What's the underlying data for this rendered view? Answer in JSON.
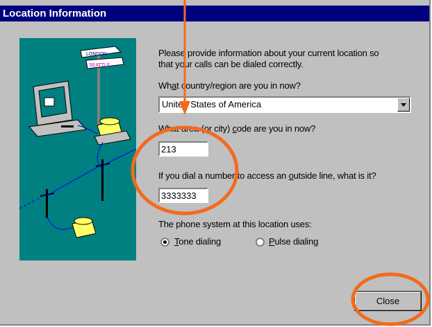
{
  "window": {
    "title": "Location Information"
  },
  "illustration": {
    "sign_top": "LONDON",
    "sign_bottom": "SEATTLE"
  },
  "content": {
    "intro_line1": "Please provide information about your current location so",
    "intro_line2": "that your calls can be dialed correctly.",
    "country_label_pre": "Wh",
    "country_label_key": "a",
    "country_label_post": "t country/region are you in now?",
    "country_value": "United States of America",
    "area_label_pre": "What area (or city) ",
    "area_label_key": "c",
    "area_label_post": "ode are you in now?",
    "area_value": "213",
    "outside_label_pre": "If you dial a number to access an ",
    "outside_label_key": "o",
    "outside_label_post": "utside line, what is it?",
    "outside_value": "3333333",
    "phone_system_label": "The phone system at this location uses:",
    "tone_key": "T",
    "tone_rest": "one dialing",
    "pulse_key": "P",
    "pulse_rest": "ulse dialing"
  },
  "buttons": {
    "close": "Close"
  },
  "annotation": {
    "color": "#f26b1d"
  }
}
